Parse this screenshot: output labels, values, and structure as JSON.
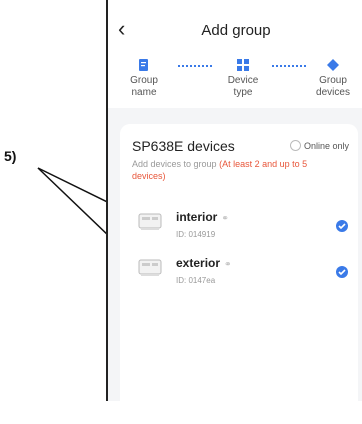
{
  "callout": {
    "label": "5)"
  },
  "header": {
    "title": "Add group",
    "back_icon": "chevron-left-icon"
  },
  "steps": [
    {
      "label": "Group name",
      "icon": "edit-doc-icon"
    },
    {
      "label": "Device type",
      "icon": "grid-icon"
    },
    {
      "label": "Group devices",
      "icon": "diamond-icon"
    }
  ],
  "card": {
    "title": "SP638E devices",
    "online_only": "Online only",
    "hint": "Add devices to group",
    "warning": "(At least 2 and up to 5 devices)"
  },
  "devices": [
    {
      "name": "interior",
      "id": "ID: 014919",
      "checked": true
    },
    {
      "name": "exterior",
      "id": "ID: 0147ea",
      "checked": true
    }
  ],
  "colors": {
    "accent": "#3a7ae8",
    "warning": "#e8563a",
    "background": "#f4f5f7"
  }
}
